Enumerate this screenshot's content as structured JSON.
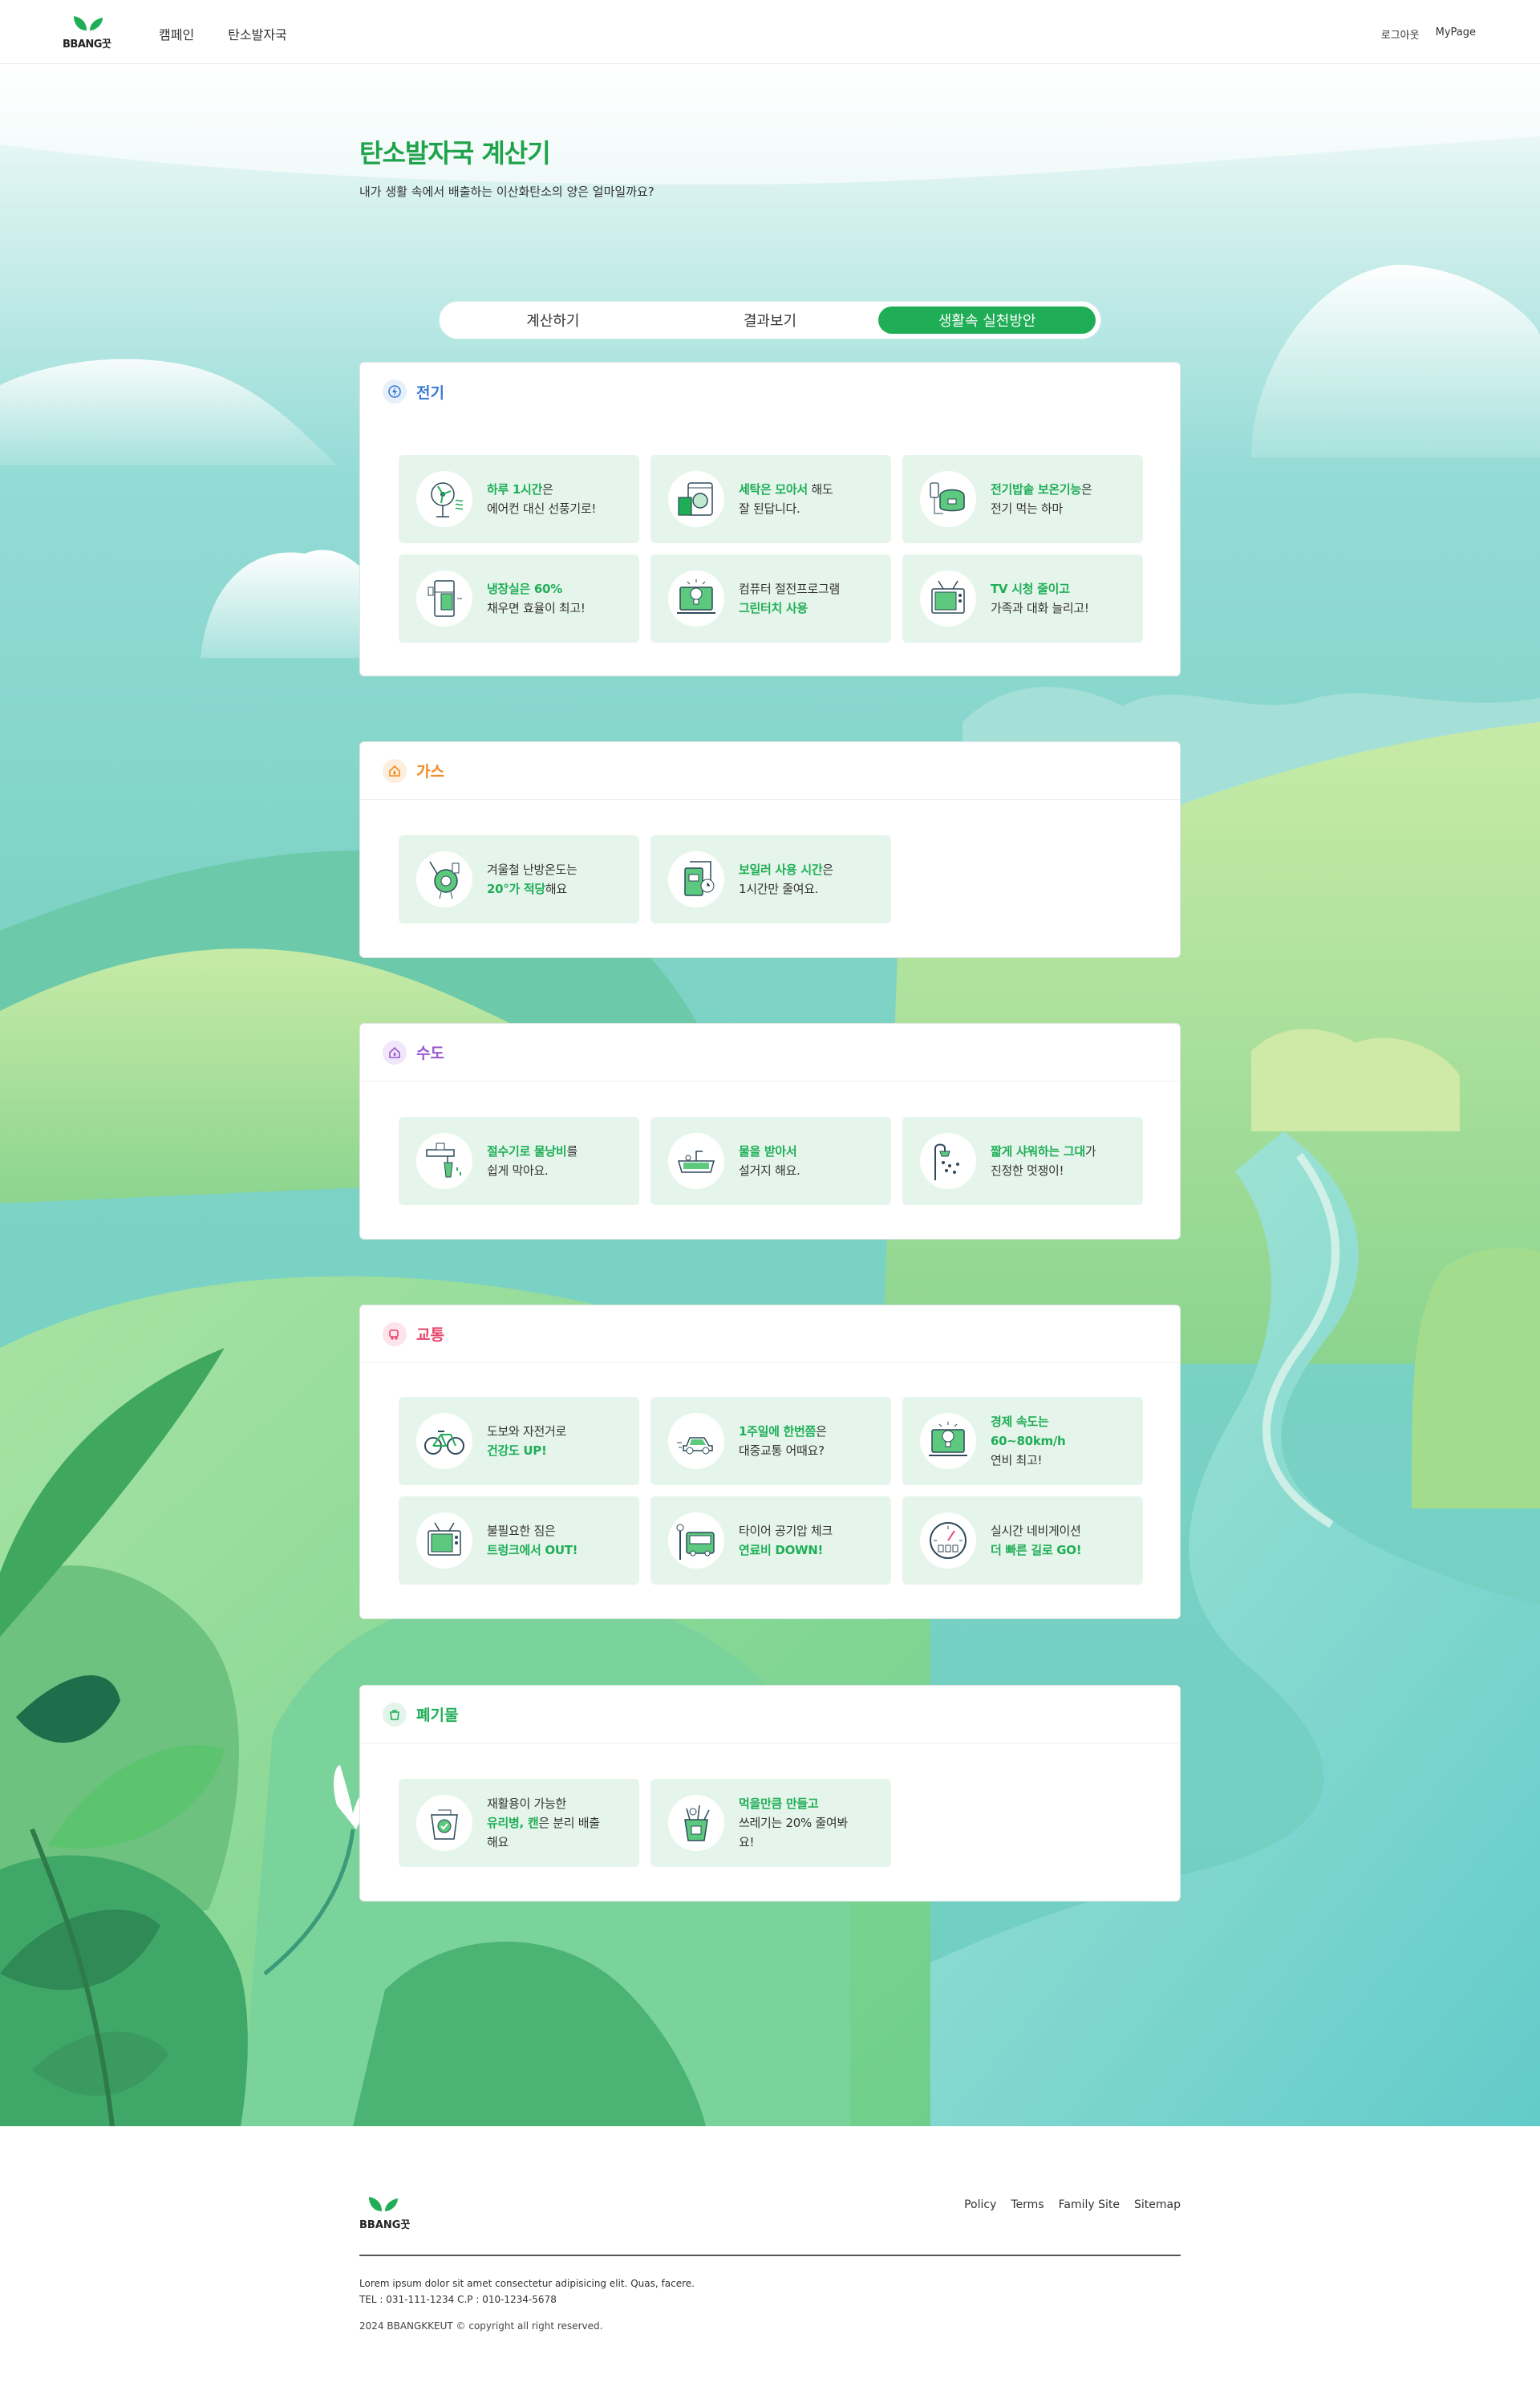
{
  "header": {
    "logo": "BBANG꿋",
    "nav": [
      "캠페인",
      "탄소발자국"
    ],
    "util": [
      "로그아웃",
      "MyPage"
    ]
  },
  "intro": {
    "title": "탄소발자국 계산기",
    "subtitle": "내가 생활 속에서 배출하는 이산화탄소의 양은 얼마일까요?"
  },
  "tabs": [
    {
      "label": "계산하기",
      "active": false
    },
    {
      "label": "결과보기",
      "active": false
    },
    {
      "label": "생활속 실천방안",
      "active": true
    }
  ],
  "categories": [
    {
      "name": "전기",
      "color": "#3a7bd5",
      "icon": "electric-icon",
      "tips": [
        {
          "icon": "fan-icon",
          "parts": [
            [
              "하루 1시간",
              true
            ],
            [
              "은",
              false
            ],
            [
              "\n에어컨 대신 선풍기로!",
              false
            ]
          ]
        },
        {
          "icon": "washing-machine-icon",
          "parts": [
            [
              "세탁은 모아서",
              true
            ],
            [
              " 해도",
              false
            ],
            [
              "\n잘 된답니다.",
              false
            ]
          ]
        },
        {
          "icon": "rice-cooker-icon",
          "parts": [
            [
              "전기밥솥 보온기능",
              true
            ],
            [
              "은",
              false
            ],
            [
              "\n전기 먹는 하마",
              false
            ]
          ]
        },
        {
          "icon": "refrigerator-icon",
          "parts": [
            [
              "냉장실은 60%",
              true
            ],
            [
              "\n채우면 효율이 최고!",
              false
            ]
          ]
        },
        {
          "icon": "computer-icon",
          "parts": [
            [
              "컴퓨터 절전프로그램",
              false
            ],
            [
              "\n그린터치 사용",
              true
            ]
          ]
        },
        {
          "icon": "tv-icon",
          "parts": [
            [
              "TV 시청 줄이고",
              true
            ],
            [
              "\n가족과 대화 늘리고!",
              false
            ]
          ]
        }
      ]
    },
    {
      "name": "가스",
      "color": "#f08a24",
      "icon": "gas-icon",
      "tips": [
        {
          "icon": "thermostat-icon",
          "parts": [
            [
              "겨울철 난방온도는",
              false
            ],
            [
              "\n20°가 적당",
              true
            ],
            [
              "해요",
              false
            ]
          ]
        },
        {
          "icon": "boiler-icon",
          "parts": [
            [
              "보일러 사용 시간",
              true
            ],
            [
              "은",
              false
            ],
            [
              "\n1시간만 줄여요.",
              false
            ]
          ]
        }
      ]
    },
    {
      "name": "수도",
      "color": "#9b59d0",
      "icon": "water-icon",
      "tips": [
        {
          "icon": "faucet-icon",
          "parts": [
            [
              "절수기로 물낭비",
              true
            ],
            [
              "를",
              false
            ],
            [
              "\n쉽게 막아요.",
              false
            ]
          ]
        },
        {
          "icon": "sink-icon",
          "parts": [
            [
              "물을 받아서",
              true
            ],
            [
              "\n설거지 해요.",
              false
            ]
          ]
        },
        {
          "icon": "shower-icon",
          "parts": [
            [
              "짧게 샤워하는 그대",
              true
            ],
            [
              "가",
              false
            ],
            [
              "\n진정한 멋쟁이!",
              false
            ]
          ]
        }
      ]
    },
    {
      "name": "교통",
      "color": "#e8456b",
      "icon": "transport-icon",
      "tips": [
        {
          "icon": "bicycle-icon",
          "parts": [
            [
              "도보와 자전거로",
              false
            ],
            [
              "\n건강도 UP!",
              true
            ]
          ]
        },
        {
          "icon": "car-icon",
          "parts": [
            [
              "1주일에 한번쯤",
              true
            ],
            [
              "은",
              false
            ],
            [
              "\n대중교통 어때요?",
              false
            ]
          ]
        },
        {
          "icon": "speed-icon",
          "parts": [
            [
              "경제 속도는",
              true
            ],
            [
              "\n60~80km/h",
              true
            ],
            [
              "\n연비 최고!",
              false
            ]
          ]
        },
        {
          "icon": "trunk-icon",
          "parts": [
            [
              "불필요한 짐은",
              false
            ],
            [
              "\n트렁크에서 OUT!",
              true
            ]
          ]
        },
        {
          "icon": "bus-icon",
          "parts": [
            [
              "타이어 공기압 체크",
              false
            ],
            [
              "\n연료비 DOWN!",
              true
            ]
          ]
        },
        {
          "icon": "navigation-icon",
          "parts": [
            [
              "실시간 네비게이션",
              false
            ],
            [
              "\n더 빠른 길로 GO!",
              true
            ]
          ]
        }
      ]
    },
    {
      "name": "폐기물",
      "color": "#1fae56",
      "icon": "waste-icon",
      "tips": [
        {
          "icon": "recycle-bin-icon",
          "parts": [
            [
              "재활용이 가능한",
              false
            ],
            [
              "\n유리병, 캔",
              true
            ],
            [
              "은 분리 배출",
              false
            ],
            [
              "\n해요",
              false
            ]
          ]
        },
        {
          "icon": "food-waste-icon",
          "parts": [
            [
              "먹을만큼 만들고",
              true
            ],
            [
              "\n쓰레기는 20% 줄여봐",
              false
            ],
            [
              "\n요!",
              false
            ]
          ]
        }
      ]
    }
  ],
  "footer": {
    "logo": "BBANG꿋",
    "links": [
      "Policy",
      "Terms",
      "Family Site",
      "Sitemap"
    ],
    "info1": "Lorem ipsum dolor sit amet consectetur adipisicing elit. Quas, facere.",
    "info2": "TEL : 031-111-1234 C.P : 010-1234-5678",
    "copyright": "2024 BBANGKKEUT © copyright all right reserved."
  }
}
